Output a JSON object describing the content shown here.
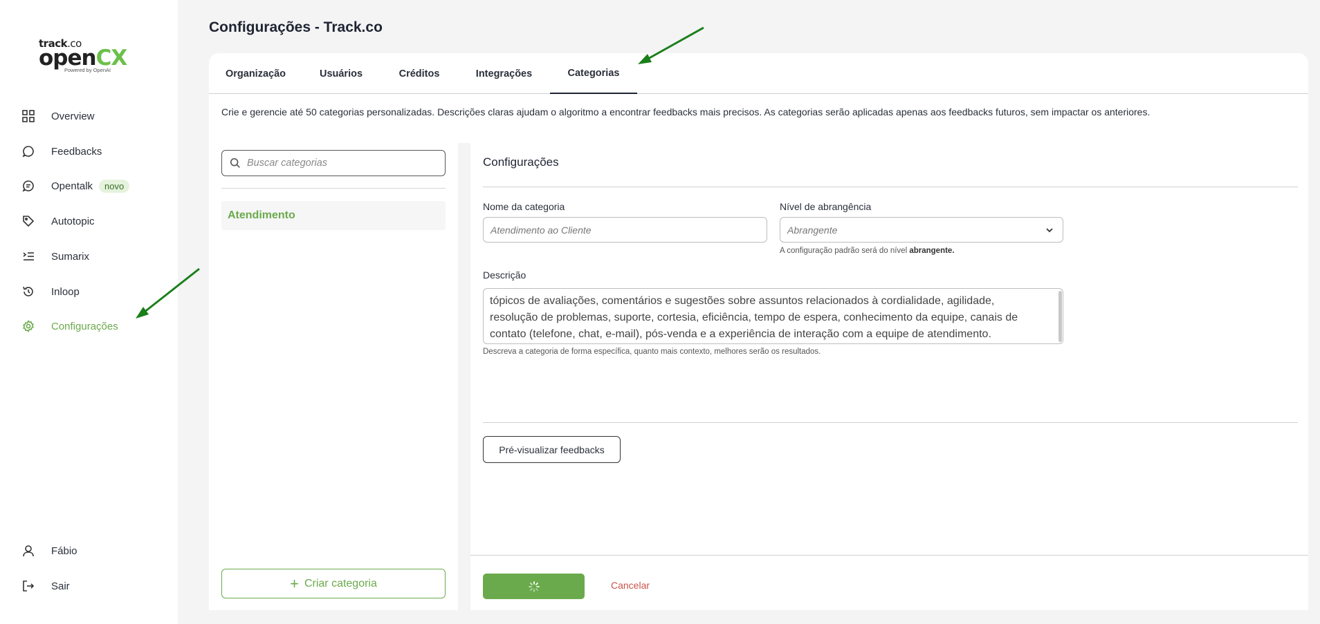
{
  "brand": {
    "line1_a": "track",
    "line1_b": ".co",
    "line2_a": "open",
    "line2_b": "CX",
    "tagline": "Powered by OpenAI"
  },
  "sidebar": {
    "items": [
      {
        "label": "Overview",
        "icon": "grid-icon"
      },
      {
        "label": "Feedbacks",
        "icon": "chat-bubble-icon"
      },
      {
        "label": "Opentalk",
        "icon": "message-lines-icon",
        "badge": "novo"
      },
      {
        "label": "Autotopic",
        "icon": "tag-icon"
      },
      {
        "label": "Sumarix",
        "icon": "list-indent-icon"
      },
      {
        "label": "Inloop",
        "icon": "history-icon"
      },
      {
        "label": "Configurações",
        "icon": "gear-icon",
        "active": true
      }
    ],
    "user": {
      "label": "Fábio",
      "icon": "user-icon"
    },
    "logout": {
      "label": "Sair",
      "icon": "logout-icon"
    }
  },
  "page": {
    "title": "Configurações - Track.co"
  },
  "tabs": [
    {
      "label": "Organização"
    },
    {
      "label": "Usuários"
    },
    {
      "label": "Créditos"
    },
    {
      "label": "Integrações"
    },
    {
      "label": "Categorias",
      "active": true
    }
  ],
  "description": "Crie e gerencie até 50 categorias personalizadas. Descrições claras ajudam o algoritmo a encontrar feedbacks mais precisos. As categorias serão aplicadas apenas aos feedbacks futuros, sem impactar os anteriores.",
  "categories_panel": {
    "search_placeholder": "Buscar categorias",
    "items": [
      "Atendimento"
    ],
    "create_label": "Criar categoria"
  },
  "config_panel": {
    "title": "Configurações",
    "name_label": "Nome da categoria",
    "name_placeholder": "Atendimento ao Cliente",
    "scope_label": "Nível de abrangência",
    "scope_value": "Abrangente",
    "scope_hint_prefix": "A configuração padrão será do nível ",
    "scope_hint_bold": "abrangente.",
    "desc_label": "Descrição",
    "desc_value": "tópicos de avaliações, comentários e sugestões sobre assuntos relacionados à cordialidade, agilidade, resolução de problemas, suporte, cortesia, eficiência, tempo de espera, conhecimento da equipe, canais de contato (telefone, chat, e-mail), pós-venda e a experiência de interação com a equipe de atendimento.",
    "desc_hint": "Descreva a categoria de forma específica, quanto mais contexto, melhores serão os resultados.",
    "preview_label": "Pré-visualizar feedbacks",
    "cancel_label": "Cancelar"
  },
  "colors": {
    "accent": "#6aaa4c",
    "annotation_arrow": "#1a7f1a",
    "cancel": "#c9534a"
  }
}
